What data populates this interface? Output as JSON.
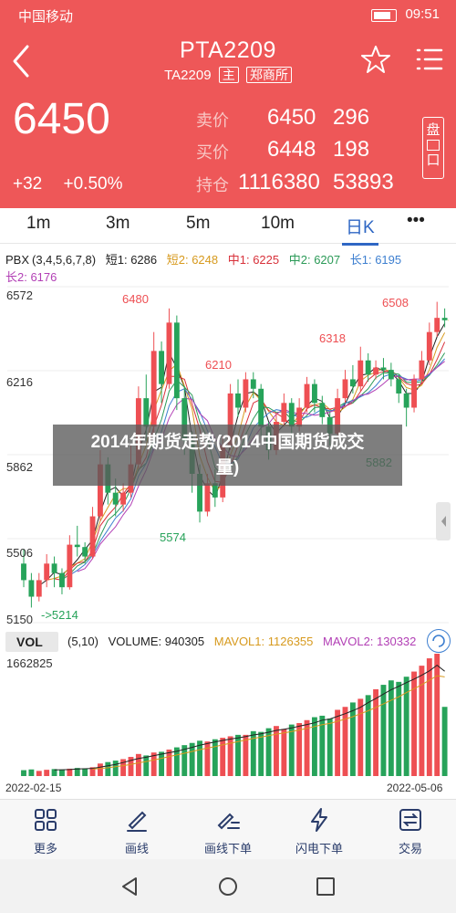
{
  "status_bar": {
    "carrier": "中国移动",
    "time": "09:51"
  },
  "header": {
    "title": "PTA2209",
    "contract_code": "TA2209",
    "tag_main": "主",
    "exchange": "郑商所",
    "last_price": "6450",
    "change": "+32",
    "change_pct": "+0.50%",
    "quotes": [
      {
        "label": "卖价",
        "price": "6450",
        "volume": "296"
      },
      {
        "label": "买价",
        "price": "6448",
        "volume": "198"
      },
      {
        "label": "持仓",
        "price": "1116380",
        "volume": "53893"
      }
    ],
    "side_button": [
      "盘",
      "口"
    ],
    "colors": {
      "header_bg": "#ee5758",
      "up": "#ee4f53",
      "down": "#27a35a",
      "active": "#2f67c4"
    }
  },
  "tabs": [
    {
      "label": "1m"
    },
    {
      "label": "3m"
    },
    {
      "label": "5m"
    },
    {
      "label": "10m"
    },
    {
      "label": "日K",
      "active": true
    },
    {
      "label": "•••"
    }
  ],
  "kline_legend": {
    "name": "PBX",
    "params": "(3,4,5,6,7,8)",
    "items": [
      {
        "label": "短1: 6286",
        "color": "#222222"
      },
      {
        "label": "短2: 6248",
        "color": "#d79a1e"
      },
      {
        "label": "中1: 6225",
        "color": "#d8313a"
      },
      {
        "label": "中2: 6207",
        "color": "#2b9a57"
      },
      {
        "label": "长1: 6195",
        "color": "#3d7fd0"
      },
      {
        "label": "长2: 6176",
        "color": "#b23fb5"
      }
    ]
  },
  "kline_axis": [
    "6572",
    "6216",
    "5862",
    "5506",
    "5150"
  ],
  "kline_annotations": {
    "high": "6480",
    "mid1": "6210",
    "mid2": "6318",
    "recent_high": "6508",
    "low_label": "5574",
    "right_low": "5882",
    "min_label": "->5214"
  },
  "volume_legend": {
    "name": "VOL",
    "params": "(5,10)",
    "volume": "VOLUME: 940305",
    "mavol1": "MAVOL1: 1126355",
    "mavol2": "MAVOL2: 130332"
  },
  "volume_axis_top": "1662825",
  "dates": {
    "start": "2022-02-15",
    "end": "2022-05-06"
  },
  "overlay": {
    "line1": "2014年期货走势(2014中国期货成交",
    "line2": "量)"
  },
  "toolbar": [
    {
      "label": "更多",
      "icon": "grid-icon"
    },
    {
      "label": "画线",
      "icon": "draw-line-icon"
    },
    {
      "label": "画线下单",
      "icon": "draw-order-icon"
    },
    {
      "label": "闪电下单",
      "icon": "lightning-icon"
    },
    {
      "label": "交易",
      "icon": "trade-icon"
    }
  ],
  "chart_data": {
    "type": "candlestick",
    "ylim": [
      5150,
      6572
    ],
    "x_start": "2022-02-15",
    "x_end": "2022-05-06",
    "candles": [
      [
        5400,
        5330,
        5460,
        5300
      ],
      [
        5330,
        5260,
        5360,
        5214
      ],
      [
        5260,
        5330,
        5360,
        5240
      ],
      [
        5330,
        5400,
        5440,
        5300
      ],
      [
        5400,
        5360,
        5430,
        5300
      ],
      [
        5360,
        5300,
        5380,
        5270
      ],
      [
        5300,
        5480,
        5520,
        5290
      ],
      [
        5480,
        5470,
        5560,
        5430
      ],
      [
        5470,
        5430,
        5490,
        5400
      ],
      [
        5430,
        5600,
        5640,
        5420
      ],
      [
        5600,
        5820,
        5880,
        5580
      ],
      [
        5820,
        5700,
        5850,
        5650
      ],
      [
        5700,
        5650,
        5760,
        5600
      ],
      [
        5650,
        5700,
        5740,
        5620
      ],
      [
        5700,
        5820,
        5900,
        5680
      ],
      [
        5820,
        6100,
        6150,
        5800
      ],
      [
        6100,
        5980,
        6200,
        5920
      ],
      [
        5980,
        6300,
        6380,
        5950
      ],
      [
        6300,
        6160,
        6340,
        6080
      ],
      [
        6160,
        6420,
        6480,
        6140
      ],
      [
        6420,
        6100,
        6450,
        6050
      ],
      [
        6100,
        5920,
        6150,
        5860
      ],
      [
        5920,
        5780,
        5960,
        5700
      ],
      [
        5780,
        5620,
        5820,
        5574
      ],
      [
        5620,
        5740,
        5780,
        5600
      ],
      [
        5740,
        5680,
        5800,
        5640
      ],
      [
        5680,
        5900,
        5940,
        5660
      ],
      [
        5900,
        6120,
        6160,
        5880
      ],
      [
        6120,
        6060,
        6180,
        6020
      ],
      [
        6060,
        6180,
        6210,
        6040
      ],
      [
        6180,
        6140,
        6210,
        6100
      ],
      [
        6140,
        5980,
        6160,
        5940
      ],
      [
        5980,
        5880,
        6000,
        5840
      ],
      [
        5880,
        6000,
        6040,
        5860
      ],
      [
        6000,
        6080,
        6120,
        5980
      ],
      [
        6080,
        5980,
        6100,
        5940
      ],
      [
        5980,
        6060,
        6100,
        5960
      ],
      [
        6060,
        6160,
        6190,
        6040
      ],
      [
        6160,
        6080,
        6180,
        6040
      ],
      [
        6080,
        6020,
        6110,
        5990
      ],
      [
        6020,
        5950,
        6040,
        5900
      ],
      [
        5950,
        6100,
        6140,
        5930
      ],
      [
        6100,
        6180,
        6220,
        6080
      ],
      [
        6180,
        6150,
        6240,
        6120
      ],
      [
        6150,
        6260,
        6318,
        6130
      ],
      [
        6260,
        6200,
        6290,
        6170
      ],
      [
        6200,
        6230,
        6260,
        6180
      ],
      [
        6230,
        6220,
        6270,
        6180
      ],
      [
        6220,
        6180,
        6250,
        6150
      ],
      [
        6180,
        6120,
        6200,
        6080
      ],
      [
        6120,
        6060,
        6140,
        5980
      ],
      [
        6060,
        6180,
        6200,
        6040
      ],
      [
        6180,
        6260,
        6300,
        6160
      ],
      [
        6260,
        6380,
        6420,
        6240
      ],
      [
        6380,
        6440,
        6508,
        6360
      ],
      [
        6440,
        6430,
        6480,
        6400
      ]
    ],
    "volumes": [
      80000,
      90000,
      70000,
      85000,
      95000,
      88000,
      100000,
      110000,
      105000,
      120000,
      170000,
      190000,
      210000,
      230000,
      260000,
      300000,
      280000,
      320000,
      330000,
      360000,
      390000,
      420000,
      450000,
      480000,
      470000,
      500000,
      520000,
      540000,
      560000,
      560000,
      610000,
      600000,
      650000,
      680000,
      640000,
      700000,
      720000,
      760000,
      800000,
      820000,
      780000,
      900000,
      940000,
      1000000,
      1050000,
      1100000,
      1180000,
      1240000,
      1300000,
      1280000,
      1350000,
      1420000,
      1500000,
      1600000,
      1662825,
      940305
    ]
  }
}
